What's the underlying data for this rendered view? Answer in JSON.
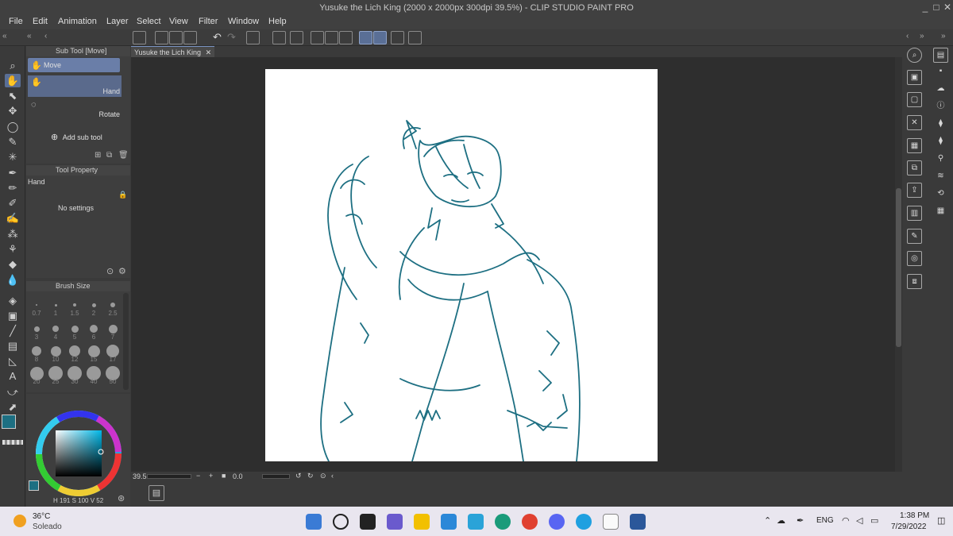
{
  "window": {
    "title": "Yusuke the Lich King (2000 x 2000px 300dpi 39.5%)  - CLIP STUDIO PAINT PRO",
    "minimize": "_",
    "maximize": "□",
    "close": "✕"
  },
  "menu": [
    "File",
    "Edit",
    "Animation",
    "Layer",
    "Select",
    "View",
    "Filter",
    "Window",
    "Help"
  ],
  "document_tab": {
    "label": "Yusuke the Lich King",
    "close": "✕"
  },
  "sub_tool": {
    "header": "Sub Tool [Move]",
    "group": "Move",
    "items": [
      "Hand",
      "Rotate"
    ],
    "add": "Add sub tool"
  },
  "tool_property": {
    "header": "Tool Property",
    "tool_name": "Hand",
    "empty": "No settings"
  },
  "brush_size": {
    "header": "Brush Size",
    "sizes": [
      "0.7",
      "1",
      "1.5",
      "2",
      "2.5",
      "3",
      "4",
      "5",
      "6",
      "7",
      "8",
      "10",
      "12",
      "15",
      "17",
      "20",
      "25",
      "30",
      "40",
      "50"
    ]
  },
  "color": {
    "main": "#1d6f82",
    "sub": "#ffffff",
    "readout": "H 191  S 100  V 52"
  },
  "status": {
    "zoom": "39.5",
    "angle": "0.0"
  },
  "taskbar": {
    "weather_temp": "36°C",
    "weather_desc": "Soleado",
    "lang": "ENG",
    "time": "1:38 PM",
    "date": "7/29/2022"
  },
  "colors": {
    "accent": "#5a6f96",
    "line_art": "#1d6f82"
  }
}
